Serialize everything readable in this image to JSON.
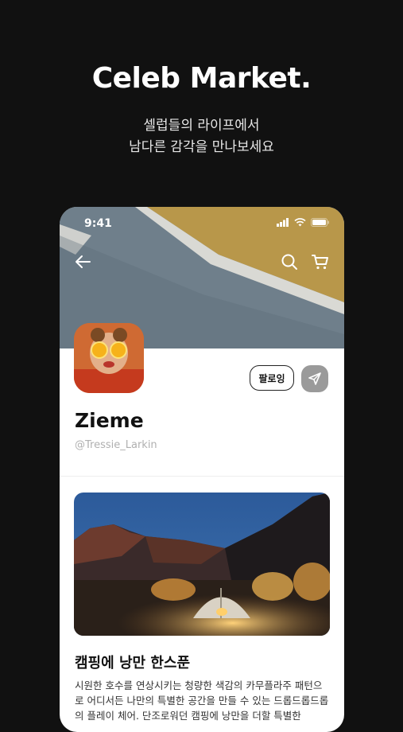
{
  "hero": {
    "title": "Celeb Market.",
    "subtitle_line1": "셀럽들의 라이프에서",
    "subtitle_line2": "남다른 감각을 만나보세요"
  },
  "status_bar": {
    "time": "9:41"
  },
  "profile": {
    "name": "Zieme",
    "handle": "@Tressie_Larkin",
    "follow_label": "팔로잉"
  },
  "post": {
    "title": "캠핑에 낭만 한스푼",
    "body": "시원한 호수를 연상시키는 청량한 색감의 카무플라주 패턴으로 어디서든 나만의 특별한 공간을 만들 수 있는 드롭드롭드롭의 플레이 체어. 단조로워던 캠핑에 낭만을 더할 특별한"
  },
  "icons": {
    "back": "arrow-left-icon",
    "search": "search-icon",
    "cart": "cart-icon",
    "share": "paper-plane-icon",
    "signal": "signal-icon",
    "wifi": "wifi-icon",
    "battery": "battery-icon"
  },
  "colors": {
    "page_bg": "#111111",
    "follow_border": "#222222",
    "share_bg": "#9a9a9a",
    "handle_text": "#b0b0b0"
  }
}
